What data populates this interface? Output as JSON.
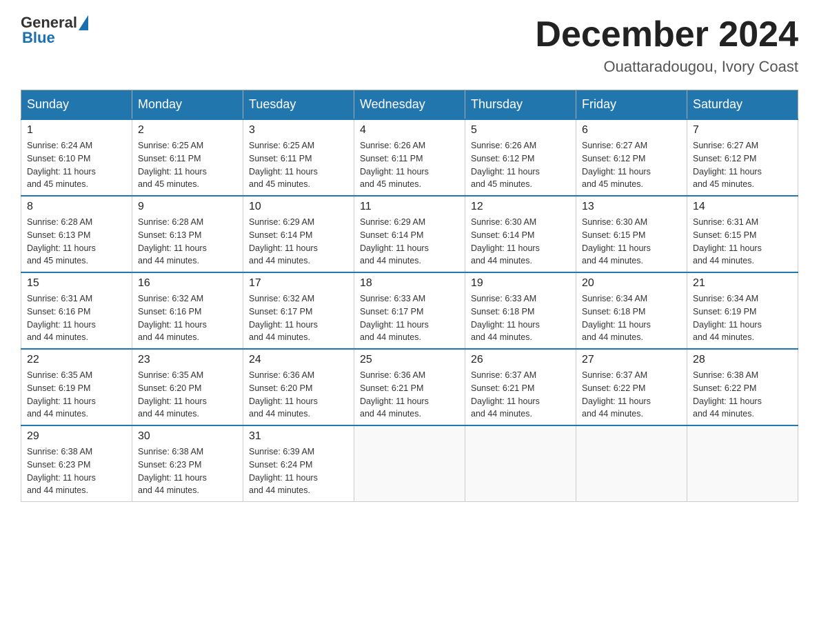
{
  "header": {
    "logo_text_general": "General",
    "logo_text_blue": "Blue",
    "month_title": "December 2024",
    "location": "Ouattaradougou, Ivory Coast"
  },
  "days_of_week": [
    "Sunday",
    "Monday",
    "Tuesday",
    "Wednesday",
    "Thursday",
    "Friday",
    "Saturday"
  ],
  "weeks": [
    [
      {
        "day": "1",
        "sunrise": "6:24 AM",
        "sunset": "6:10 PM",
        "daylight": "11 hours and 45 minutes."
      },
      {
        "day": "2",
        "sunrise": "6:25 AM",
        "sunset": "6:11 PM",
        "daylight": "11 hours and 45 minutes."
      },
      {
        "day": "3",
        "sunrise": "6:25 AM",
        "sunset": "6:11 PM",
        "daylight": "11 hours and 45 minutes."
      },
      {
        "day": "4",
        "sunrise": "6:26 AM",
        "sunset": "6:11 PM",
        "daylight": "11 hours and 45 minutes."
      },
      {
        "day": "5",
        "sunrise": "6:26 AM",
        "sunset": "6:12 PM",
        "daylight": "11 hours and 45 minutes."
      },
      {
        "day": "6",
        "sunrise": "6:27 AM",
        "sunset": "6:12 PM",
        "daylight": "11 hours and 45 minutes."
      },
      {
        "day": "7",
        "sunrise": "6:27 AM",
        "sunset": "6:12 PM",
        "daylight": "11 hours and 45 minutes."
      }
    ],
    [
      {
        "day": "8",
        "sunrise": "6:28 AM",
        "sunset": "6:13 PM",
        "daylight": "11 hours and 45 minutes."
      },
      {
        "day": "9",
        "sunrise": "6:28 AM",
        "sunset": "6:13 PM",
        "daylight": "11 hours and 44 minutes."
      },
      {
        "day": "10",
        "sunrise": "6:29 AM",
        "sunset": "6:14 PM",
        "daylight": "11 hours and 44 minutes."
      },
      {
        "day": "11",
        "sunrise": "6:29 AM",
        "sunset": "6:14 PM",
        "daylight": "11 hours and 44 minutes."
      },
      {
        "day": "12",
        "sunrise": "6:30 AM",
        "sunset": "6:14 PM",
        "daylight": "11 hours and 44 minutes."
      },
      {
        "day": "13",
        "sunrise": "6:30 AM",
        "sunset": "6:15 PM",
        "daylight": "11 hours and 44 minutes."
      },
      {
        "day": "14",
        "sunrise": "6:31 AM",
        "sunset": "6:15 PM",
        "daylight": "11 hours and 44 minutes."
      }
    ],
    [
      {
        "day": "15",
        "sunrise": "6:31 AM",
        "sunset": "6:16 PM",
        "daylight": "11 hours and 44 minutes."
      },
      {
        "day": "16",
        "sunrise": "6:32 AM",
        "sunset": "6:16 PM",
        "daylight": "11 hours and 44 minutes."
      },
      {
        "day": "17",
        "sunrise": "6:32 AM",
        "sunset": "6:17 PM",
        "daylight": "11 hours and 44 minutes."
      },
      {
        "day": "18",
        "sunrise": "6:33 AM",
        "sunset": "6:17 PM",
        "daylight": "11 hours and 44 minutes."
      },
      {
        "day": "19",
        "sunrise": "6:33 AM",
        "sunset": "6:18 PM",
        "daylight": "11 hours and 44 minutes."
      },
      {
        "day": "20",
        "sunrise": "6:34 AM",
        "sunset": "6:18 PM",
        "daylight": "11 hours and 44 minutes."
      },
      {
        "day": "21",
        "sunrise": "6:34 AM",
        "sunset": "6:19 PM",
        "daylight": "11 hours and 44 minutes."
      }
    ],
    [
      {
        "day": "22",
        "sunrise": "6:35 AM",
        "sunset": "6:19 PM",
        "daylight": "11 hours and 44 minutes."
      },
      {
        "day": "23",
        "sunrise": "6:35 AM",
        "sunset": "6:20 PM",
        "daylight": "11 hours and 44 minutes."
      },
      {
        "day": "24",
        "sunrise": "6:36 AM",
        "sunset": "6:20 PM",
        "daylight": "11 hours and 44 minutes."
      },
      {
        "day": "25",
        "sunrise": "6:36 AM",
        "sunset": "6:21 PM",
        "daylight": "11 hours and 44 minutes."
      },
      {
        "day": "26",
        "sunrise": "6:37 AM",
        "sunset": "6:21 PM",
        "daylight": "11 hours and 44 minutes."
      },
      {
        "day": "27",
        "sunrise": "6:37 AM",
        "sunset": "6:22 PM",
        "daylight": "11 hours and 44 minutes."
      },
      {
        "day": "28",
        "sunrise": "6:38 AM",
        "sunset": "6:22 PM",
        "daylight": "11 hours and 44 minutes."
      }
    ],
    [
      {
        "day": "29",
        "sunrise": "6:38 AM",
        "sunset": "6:23 PM",
        "daylight": "11 hours and 44 minutes."
      },
      {
        "day": "30",
        "sunrise": "6:38 AM",
        "sunset": "6:23 PM",
        "daylight": "11 hours and 44 minutes."
      },
      {
        "day": "31",
        "sunrise": "6:39 AM",
        "sunset": "6:24 PM",
        "daylight": "11 hours and 44 minutes."
      },
      null,
      null,
      null,
      null
    ]
  ],
  "labels": {
    "sunrise": "Sunrise:",
    "sunset": "Sunset:",
    "daylight": "Daylight:"
  }
}
